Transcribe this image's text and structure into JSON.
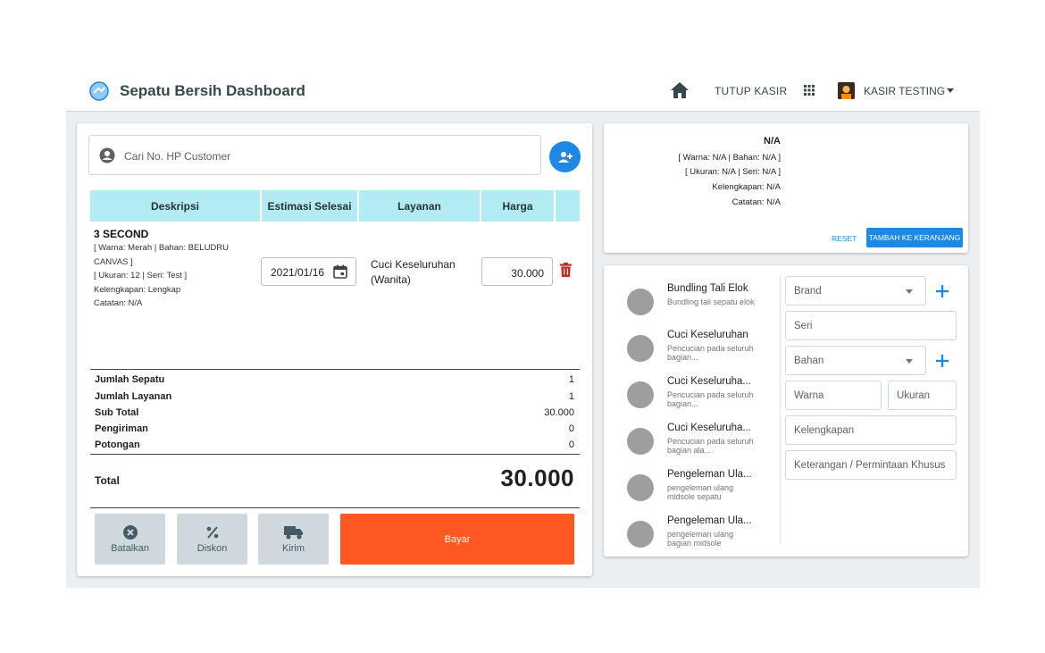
{
  "header": {
    "title": "Sepatu Bersih Dashboard",
    "tutup_kasir": "TUTUP KASIR",
    "user": "KASIR TESTING"
  },
  "search": {
    "placeholder": "Cari No. HP Customer"
  },
  "table": {
    "headers": [
      "Deskripsi",
      "Estimasi Selesai",
      "Layanan",
      "Harga"
    ]
  },
  "item": {
    "name": "3 SECOND",
    "detail_1": "[ Warna: Merah | Bahan: BELUDRU CANVAS ]",
    "detail_2": "[ Ukuran: 12 | Seri: Test ]",
    "detail_3": "Kelengkapan: Lengkap",
    "detail_4": "Catatan: N/A",
    "date": "2021/01/16",
    "layanan": "Cuci Keseluruhan (Wanita)",
    "harga": "30.000"
  },
  "summary": {
    "rows": [
      {
        "label": "Jumlah Sepatu",
        "value": "1"
      },
      {
        "label": "Jumlah Layanan",
        "value": "1"
      },
      {
        "label": "Sub Total",
        "value": "30.000"
      },
      {
        "label": "Pengiriman",
        "value": "0"
      },
      {
        "label": "Potongan",
        "value": "0"
      }
    ],
    "total_label": "Total",
    "total_value": "30.000"
  },
  "actions": {
    "batalkan": "Batalkan",
    "diskon": "Diskon",
    "kirim": "Kirim",
    "bayar": "Bayar"
  },
  "preview": {
    "title": "N/A",
    "line_1": "[ Warna: N/A | Bahan: N/A ]",
    "line_2": "[ Ukuran: N/A | Seri: N/A ]",
    "line_3": "Kelengkapan: N/A",
    "line_4": "Catatan: N/A",
    "reset": "RESET",
    "tambah": "TAMBAH KE KERANJANG"
  },
  "services": [
    {
      "name": "Bundling Tali Elok",
      "desc": "Bundling tali sepatu elok"
    },
    {
      "name": "Cuci Keseluruhan",
      "desc": "Pencucian pada seluruh bagian..."
    },
    {
      "name": "Cuci Keseluruha...",
      "desc": "Pencucian pada seluruh bagian..."
    },
    {
      "name": "Cuci Keseluruha...",
      "desc": "Pencucian pada seluruh bagian ala..."
    },
    {
      "name": "Pengeleman Ula...",
      "desc": "pengeleman ulang midsole sepatu"
    },
    {
      "name": "Pengeleman Ula...",
      "desc": "pengeleman ulang bagian midsole"
    }
  ],
  "form": {
    "brand": "Brand",
    "seri": "Seri",
    "bahan": "Bahan",
    "warna": "Warna",
    "ukuran": "Ukuran",
    "kelengkapan": "Kelengkapan",
    "keterangan": "Keterangan / Permintaan Khusus"
  },
  "colors": {
    "accent": "#1e88e5",
    "pay": "#ff5722",
    "table_header": "#b2ebf2",
    "delete": "#c62828"
  }
}
